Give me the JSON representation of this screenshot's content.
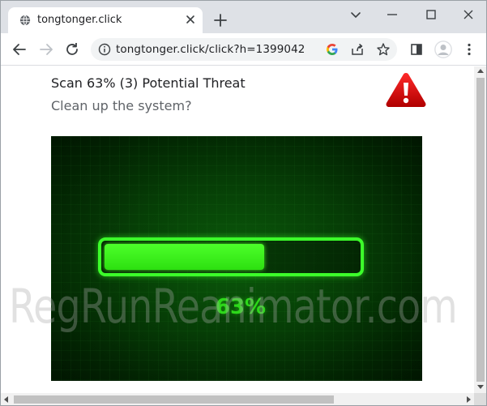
{
  "browser": {
    "tab_title": "tongtonger.click",
    "url": "tongtonger.click/click?h=1399042"
  },
  "page": {
    "heading": "Scan 63% (3) Potential Threat",
    "subheading": "Clean up the system?",
    "progress": {
      "percent_label": "63%",
      "fraction": 0.63,
      "bar_color": "#3cff2a",
      "text_color": "#2dd81a"
    },
    "watermark": "RegRunReanimator.com"
  },
  "icons": {
    "favicon": "globe-icon",
    "warning": "warning-triangle-icon"
  },
  "colors": {
    "tabstrip_bg": "#dee1e6",
    "omnibox_bg": "#f1f3f4",
    "warning_red": "#d50000",
    "panel_green": "#063d06"
  }
}
